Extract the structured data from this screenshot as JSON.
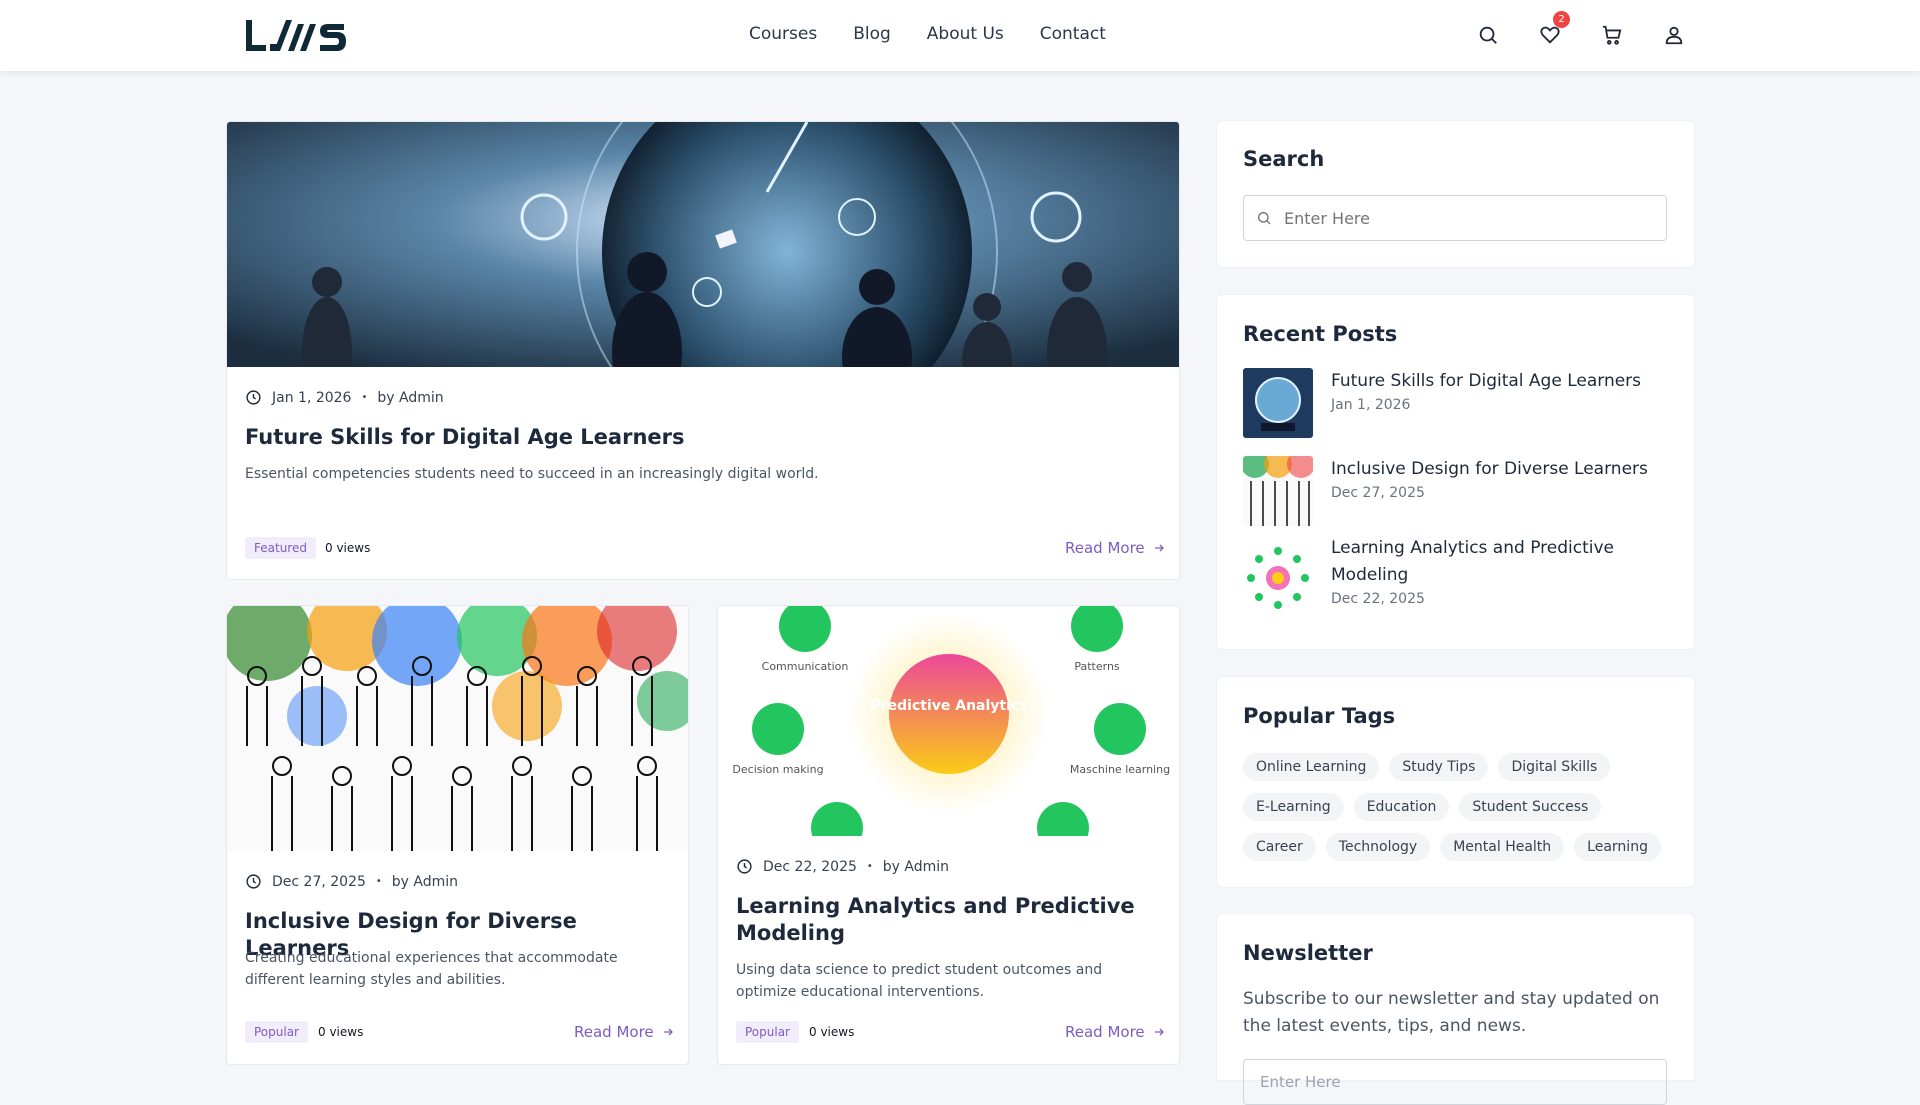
{
  "header": {
    "logo": "LMS",
    "nav": [
      "Courses",
      "Blog",
      "About Us",
      "Contact"
    ],
    "wishlist_count": "2",
    "icons": [
      "search-icon",
      "heart-icon",
      "cart-icon",
      "user-icon"
    ]
  },
  "posts": [
    {
      "date": "Jan 1, 2026",
      "author": "by Admin",
      "title": "Future Skills for Digital Age Learners",
      "desc": "Essential competencies students need to succeed in an increasingly digital world.",
      "tag": "Featured",
      "views": "0 views",
      "read_more": "Read More"
    },
    {
      "date": "Dec 27, 2025",
      "author": "by Admin",
      "title": "Inclusive Design for Diverse Learners",
      "desc": "Creating educational experiences that accommodate different learning styles and abilities.",
      "tag": "Popular",
      "views": "0 views",
      "read_more": "Read More"
    },
    {
      "date": "Dec 22, 2025",
      "author": "by Admin",
      "title": "Learning Analytics and Predictive Modeling",
      "desc": "Using data science to predict student outcomes and optimize educational interventions.",
      "tag": "Popular",
      "views": "0 views",
      "read_more": "Read More",
      "diagram": {
        "center": "Predictive Analytics",
        "nodes": [
          "Communication",
          "Patterns",
          "Decision making",
          "Maschine learning"
        ]
      }
    }
  ],
  "sidebar": {
    "search": {
      "title": "Search",
      "placeholder": "Enter Here"
    },
    "recent": {
      "title": "Recent Posts",
      "items": [
        {
          "title": "Future Skills for Digital Age Learners",
          "date": "Jan 1, 2026"
        },
        {
          "title": "Inclusive Design for Diverse Learners",
          "date": "Dec 27, 2025"
        },
        {
          "title": "Learning Analytics and Predictive Modeling",
          "date": "Dec 22, 2025"
        }
      ]
    },
    "tags": {
      "title": "Popular Tags",
      "items": [
        "Online Learning",
        "Study Tips",
        "Digital Skills",
        "E-Learning",
        "Education",
        "Student Success",
        "Career",
        "Technology",
        "Mental Health",
        "Learning"
      ]
    },
    "newsletter": {
      "title": "Newsletter",
      "text": "Subscribe to our newsletter and stay updated on the latest events, tips, and news.",
      "placeholder": "Enter Here"
    }
  },
  "colors": {
    "accent": "#7c5cc4",
    "badge": "#ef4444",
    "logo": "#0f2a36"
  }
}
